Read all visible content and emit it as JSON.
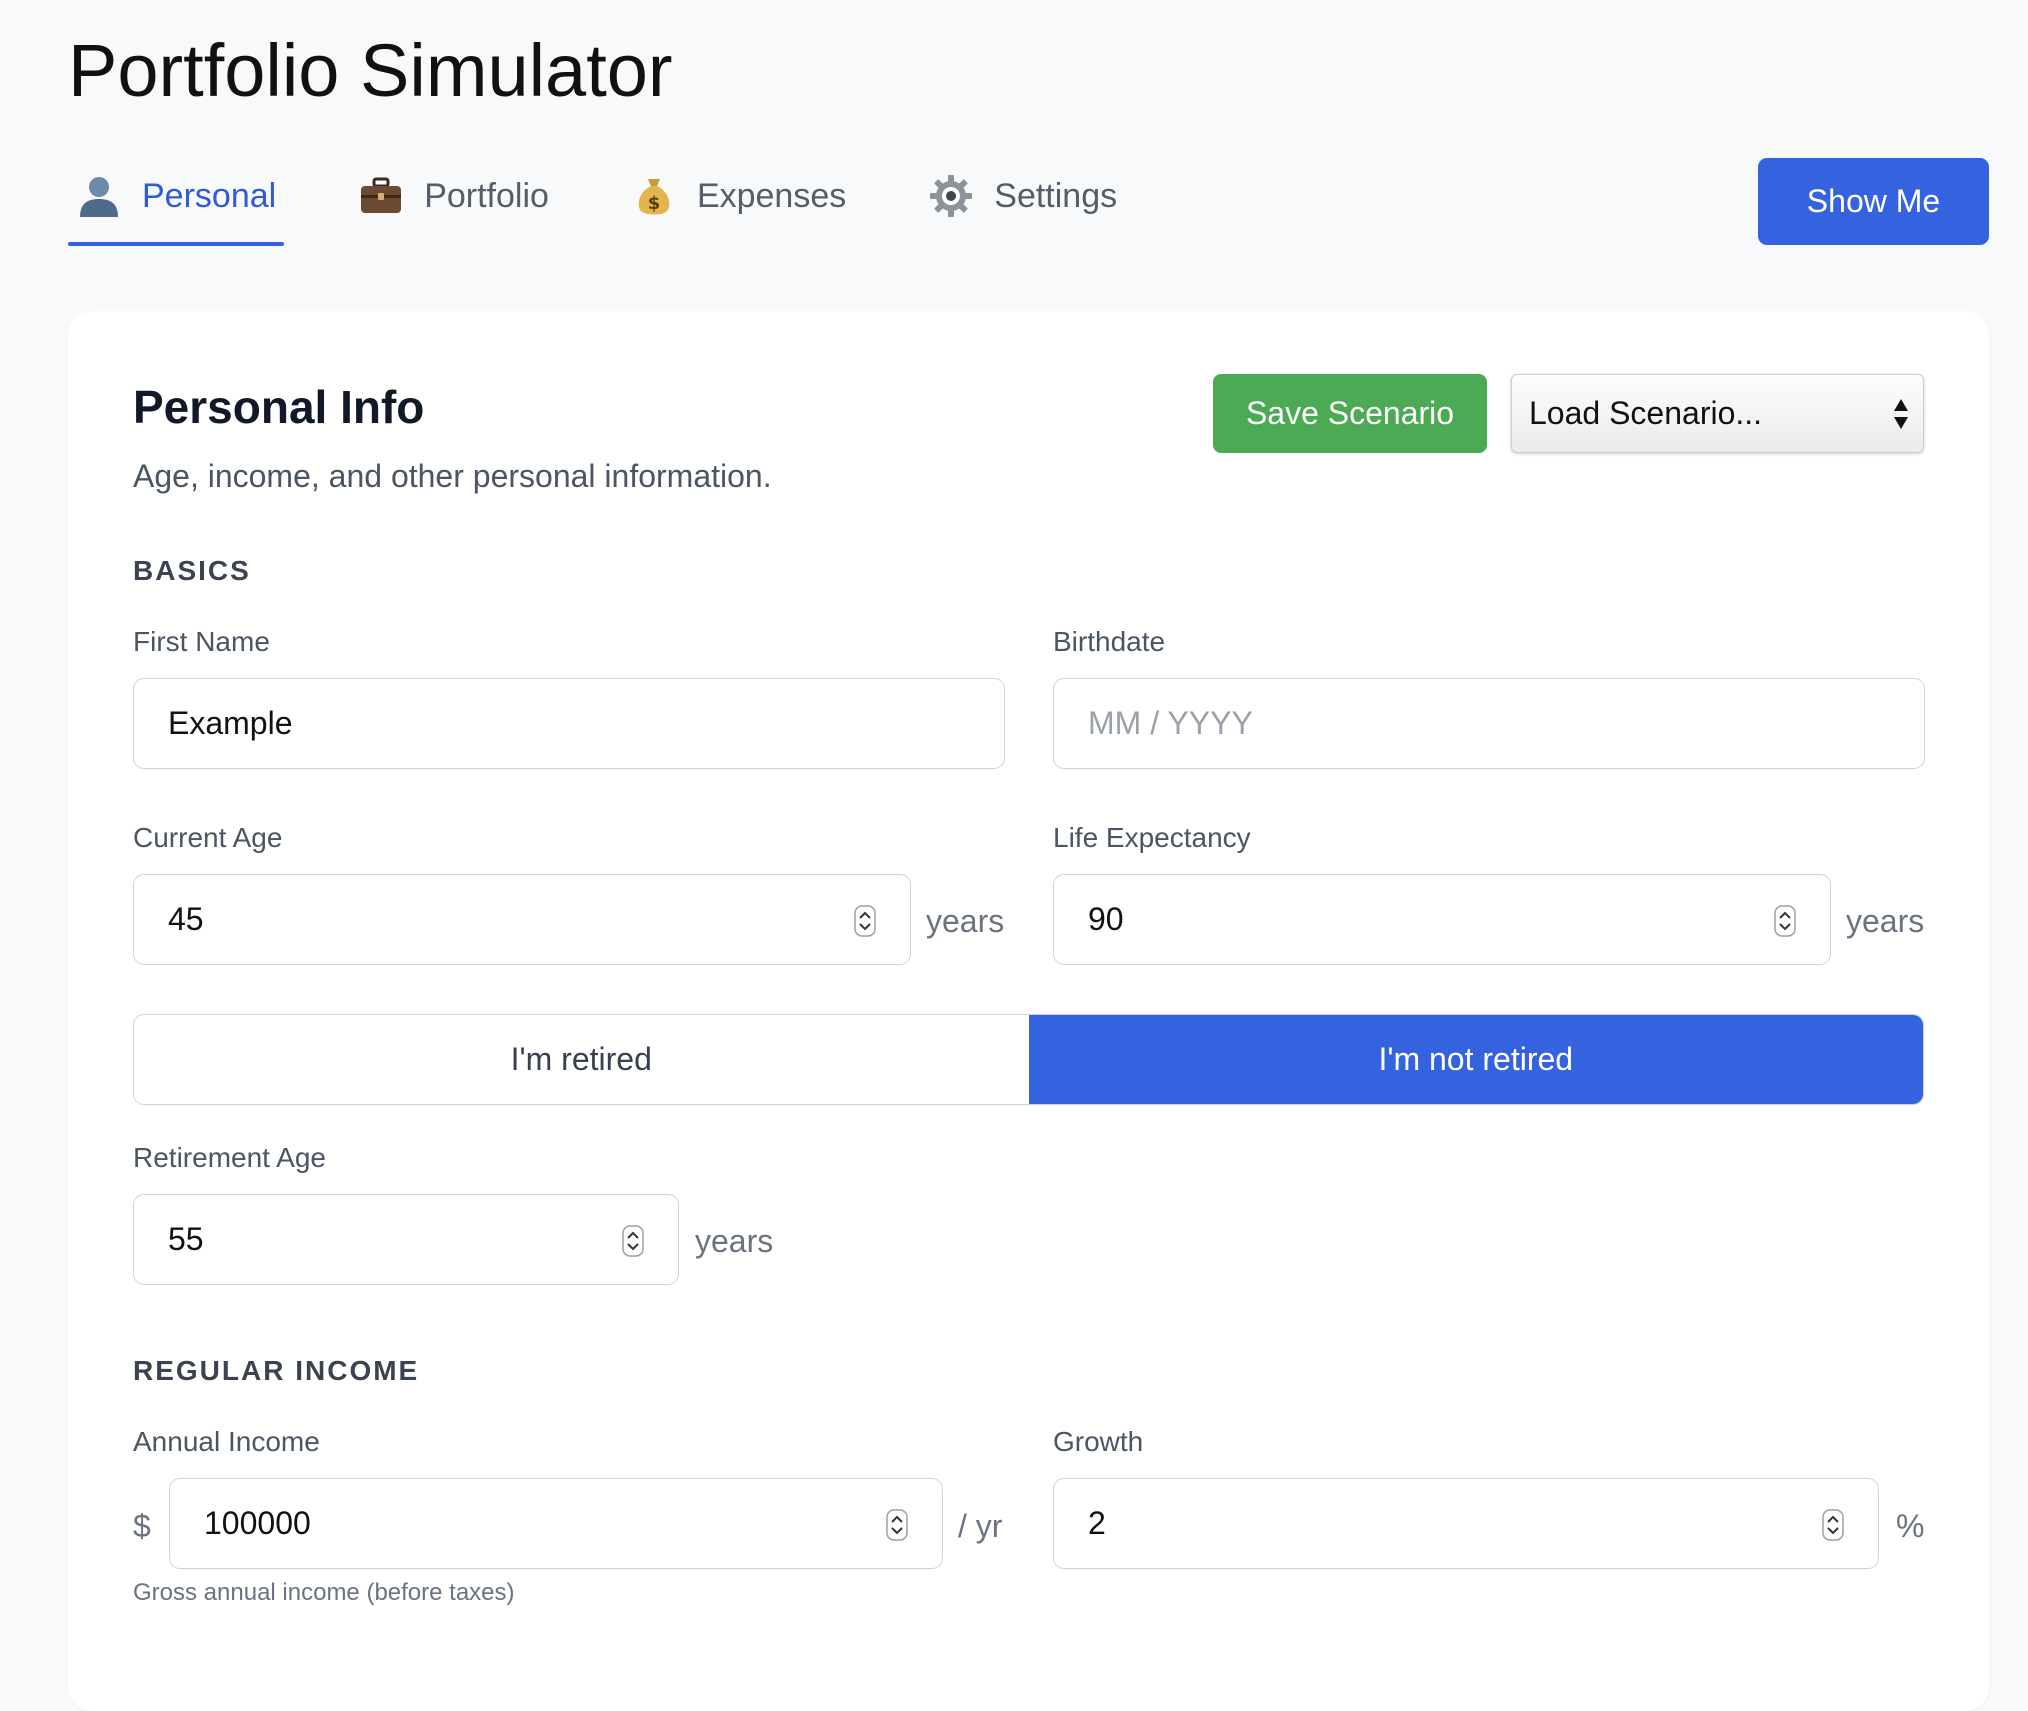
{
  "app": {
    "title": "Portfolio Simulator"
  },
  "tabs": [
    {
      "label": "Personal",
      "icon": "person-icon",
      "active": true
    },
    {
      "label": "Portfolio",
      "icon": "briefcase-icon",
      "active": false
    },
    {
      "label": "Expenses",
      "icon": "money-bag-icon",
      "active": false
    },
    {
      "label": "Settings",
      "icon": "gear-icon",
      "active": false
    }
  ],
  "header": {
    "show_me_label": "Show Me"
  },
  "section": {
    "title": "Personal Info",
    "subtitle": "Age, income, and other personal information.",
    "save_label": "Save Scenario",
    "load_label": "Load Scenario..."
  },
  "basics": {
    "heading": "BASICS",
    "first_name": {
      "label": "First Name",
      "value": "Example"
    },
    "birthdate": {
      "label": "Birthdate",
      "placeholder": "MM / YYYY"
    },
    "current_age": {
      "label": "Current Age",
      "value": "45",
      "unit": "years"
    },
    "life_expectancy": {
      "label": "Life Expectancy",
      "value": "90",
      "unit": "years"
    },
    "retired_option": "I'm retired",
    "not_retired_option": "I'm not retired",
    "selected": "not_retired",
    "retirement_age": {
      "label": "Retirement Age",
      "value": "55",
      "unit": "years"
    }
  },
  "income": {
    "heading": "REGULAR INCOME",
    "annual_income": {
      "label": "Annual Income",
      "prefix": "$",
      "value": "100000",
      "unit": "/ yr",
      "help": "Gross annual income (before taxes)"
    },
    "growth": {
      "label": "Growth",
      "value": "2",
      "unit": "%"
    }
  },
  "colors": {
    "accent": "#3563e0",
    "save": "#4caa55",
    "background": "#f8f9fb"
  }
}
